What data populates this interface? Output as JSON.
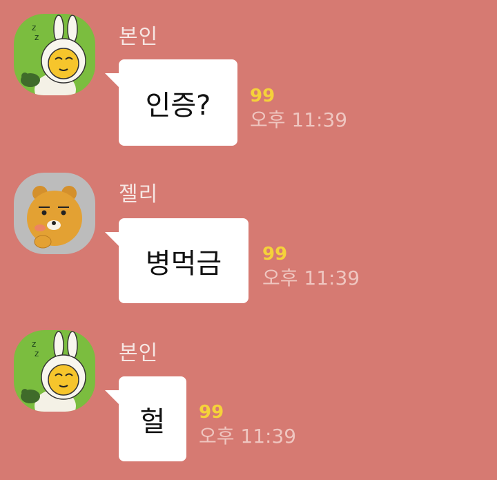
{
  "messages": [
    {
      "sender": "본인",
      "text": "인증?",
      "unread": "99",
      "time": "오후 11:39",
      "avatar": "apeach-bunny-avatar"
    },
    {
      "sender": "젤리",
      "text": "병먹금",
      "unread": "99",
      "time": "오후 11:39",
      "avatar": "ryan-avatar"
    },
    {
      "sender": "본인",
      "text": "헐",
      "unread": "99",
      "time": "오후 11:39",
      "avatar": "apeach-bunny-avatar"
    }
  ],
  "colors": {
    "background": "#d67a72",
    "bubble": "#ffffff",
    "unread": "#f5d23a",
    "time": "#efc6c0",
    "sender": "#f6e6e3"
  }
}
